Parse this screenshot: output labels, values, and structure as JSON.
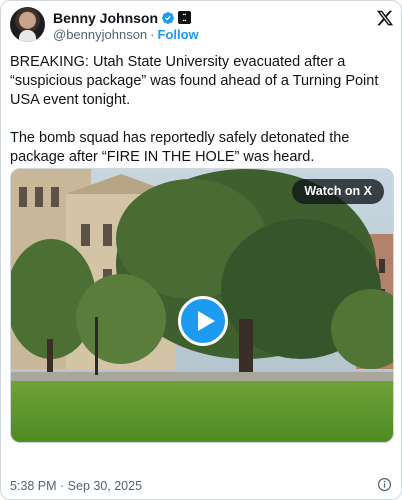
{
  "author": {
    "display_name": "Benny Johnson",
    "handle": "@bennyjohnson",
    "separator": "·",
    "follow_label": "Follow",
    "verified": true,
    "affiliate_badge_text": "THE BENNY SHOW"
  },
  "tweet": {
    "text": "BREAKING: Utah State University evacuated after a “suspicious package” was found ahead of a Turning Point USA event tonight.\n\nThe bomb squad has reportedly safely detonated the package after “FIRE IN THE HOLE” was heard."
  },
  "media": {
    "watch_label": "Watch on X",
    "play_icon": "play-icon"
  },
  "footer": {
    "timestamp": "5:38 PM · Sep 30, 2025",
    "info_icon": "info-icon"
  },
  "colors": {
    "accent": "#1d9bf0",
    "text": "#0f1419",
    "secondary": "#536471",
    "border": "#cfd9de"
  }
}
